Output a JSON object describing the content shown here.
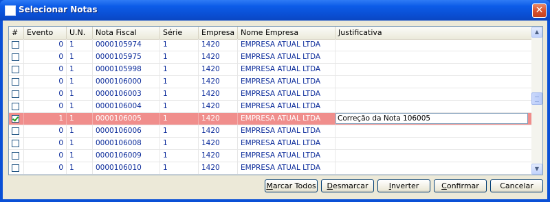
{
  "window": {
    "title": "Selecionar Notas",
    "close_glyph": "✕"
  },
  "grid": {
    "columns": [
      "#",
      "Evento",
      "U.N.",
      "Nota Fiscal",
      "Série",
      "Empresa",
      "Nome Empresa",
      "Justificativa"
    ],
    "rows": [
      {
        "checked": false,
        "evento": "0",
        "un": "1",
        "nota": "0000105974",
        "serie": "1",
        "empresa": "1420",
        "nome": "EMPRESA ATUAL LTDA",
        "justificativa": ""
      },
      {
        "checked": false,
        "evento": "0",
        "un": "1",
        "nota": "0000105975",
        "serie": "1",
        "empresa": "1420",
        "nome": "EMPRESA ATUAL LTDA",
        "justificativa": ""
      },
      {
        "checked": false,
        "evento": "0",
        "un": "1",
        "nota": "0000105998",
        "serie": "1",
        "empresa": "1420",
        "nome": "EMPRESA ATUAL LTDA",
        "justificativa": ""
      },
      {
        "checked": false,
        "evento": "0",
        "un": "1",
        "nota": "0000106000",
        "serie": "1",
        "empresa": "1420",
        "nome": "EMPRESA ATUAL LTDA",
        "justificativa": ""
      },
      {
        "checked": false,
        "evento": "0",
        "un": "1",
        "nota": "0000106003",
        "serie": "1",
        "empresa": "1420",
        "nome": "EMPRESA ATUAL LTDA",
        "justificativa": ""
      },
      {
        "checked": false,
        "evento": "0",
        "un": "1",
        "nota": "0000106004",
        "serie": "1",
        "empresa": "1420",
        "nome": "EMPRESA ATUAL LTDA",
        "justificativa": ""
      },
      {
        "checked": true,
        "selected": true,
        "evento": "1",
        "un": "1",
        "nota": "0000106005",
        "serie": "1",
        "empresa": "1420",
        "nome": "EMPRESA ATUAL LTDA",
        "justificativa": "Correção da Nota 106005"
      },
      {
        "checked": false,
        "evento": "0",
        "un": "1",
        "nota": "0000106006",
        "serie": "1",
        "empresa": "1420",
        "nome": "EMPRESA ATUAL LTDA",
        "justificativa": ""
      },
      {
        "checked": false,
        "evento": "0",
        "un": "1",
        "nota": "0000106008",
        "serie": "1",
        "empresa": "1420",
        "nome": "EMPRESA ATUAL LTDA",
        "justificativa": ""
      },
      {
        "checked": false,
        "evento": "0",
        "un": "1",
        "nota": "0000106009",
        "serie": "1",
        "empresa": "1420",
        "nome": "EMPRESA ATUAL LTDA",
        "justificativa": ""
      },
      {
        "checked": false,
        "evento": "0",
        "un": "1",
        "nota": "0000106010",
        "serie": "1",
        "empresa": "1420",
        "nome": "EMPRESA ATUAL LTDA",
        "justificativa": ""
      }
    ]
  },
  "buttons": {
    "marcar_todos": {
      "mnemonic": "M",
      "rest": "arcar Todos"
    },
    "desmarcar": {
      "mnemonic": "D",
      "rest": "esmarcar"
    },
    "inverter": {
      "mnemonic": "I",
      "rest": "nverter"
    },
    "confirmar": {
      "mnemonic": "C",
      "rest": "onfirmar"
    },
    "cancelar": {
      "label": "Cancelar"
    }
  },
  "scrollbar": {
    "up_glyph": "▲",
    "down_glyph": "▼"
  },
  "colors": {
    "titlebar": "#0a4fd4",
    "selected_row": "#f08e8c",
    "link_text": "#0a2a9a",
    "dialog_bg": "#ece9d8"
  }
}
